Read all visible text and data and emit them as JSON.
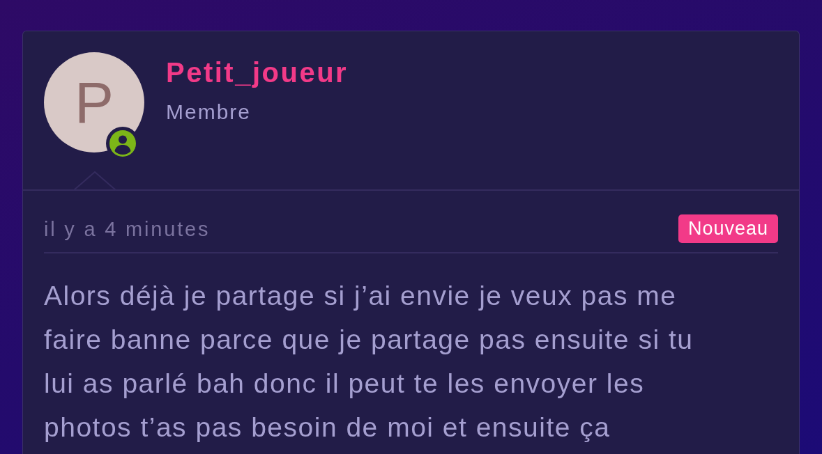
{
  "post": {
    "author": {
      "name": "Petit_joueur",
      "role": "Membre",
      "avatar_letter": "P",
      "online": true
    },
    "timestamp": "il y a 4 minutes",
    "badge": "Nouveau",
    "body": "Alors déjà je partage si j’ai envie je veux pas me faire banne parce que je partage pas ensuite si tu lui as parlé bah donc il peut te les envoyer les photos t’as pas besoin de moi et ensuite ça"
  }
}
